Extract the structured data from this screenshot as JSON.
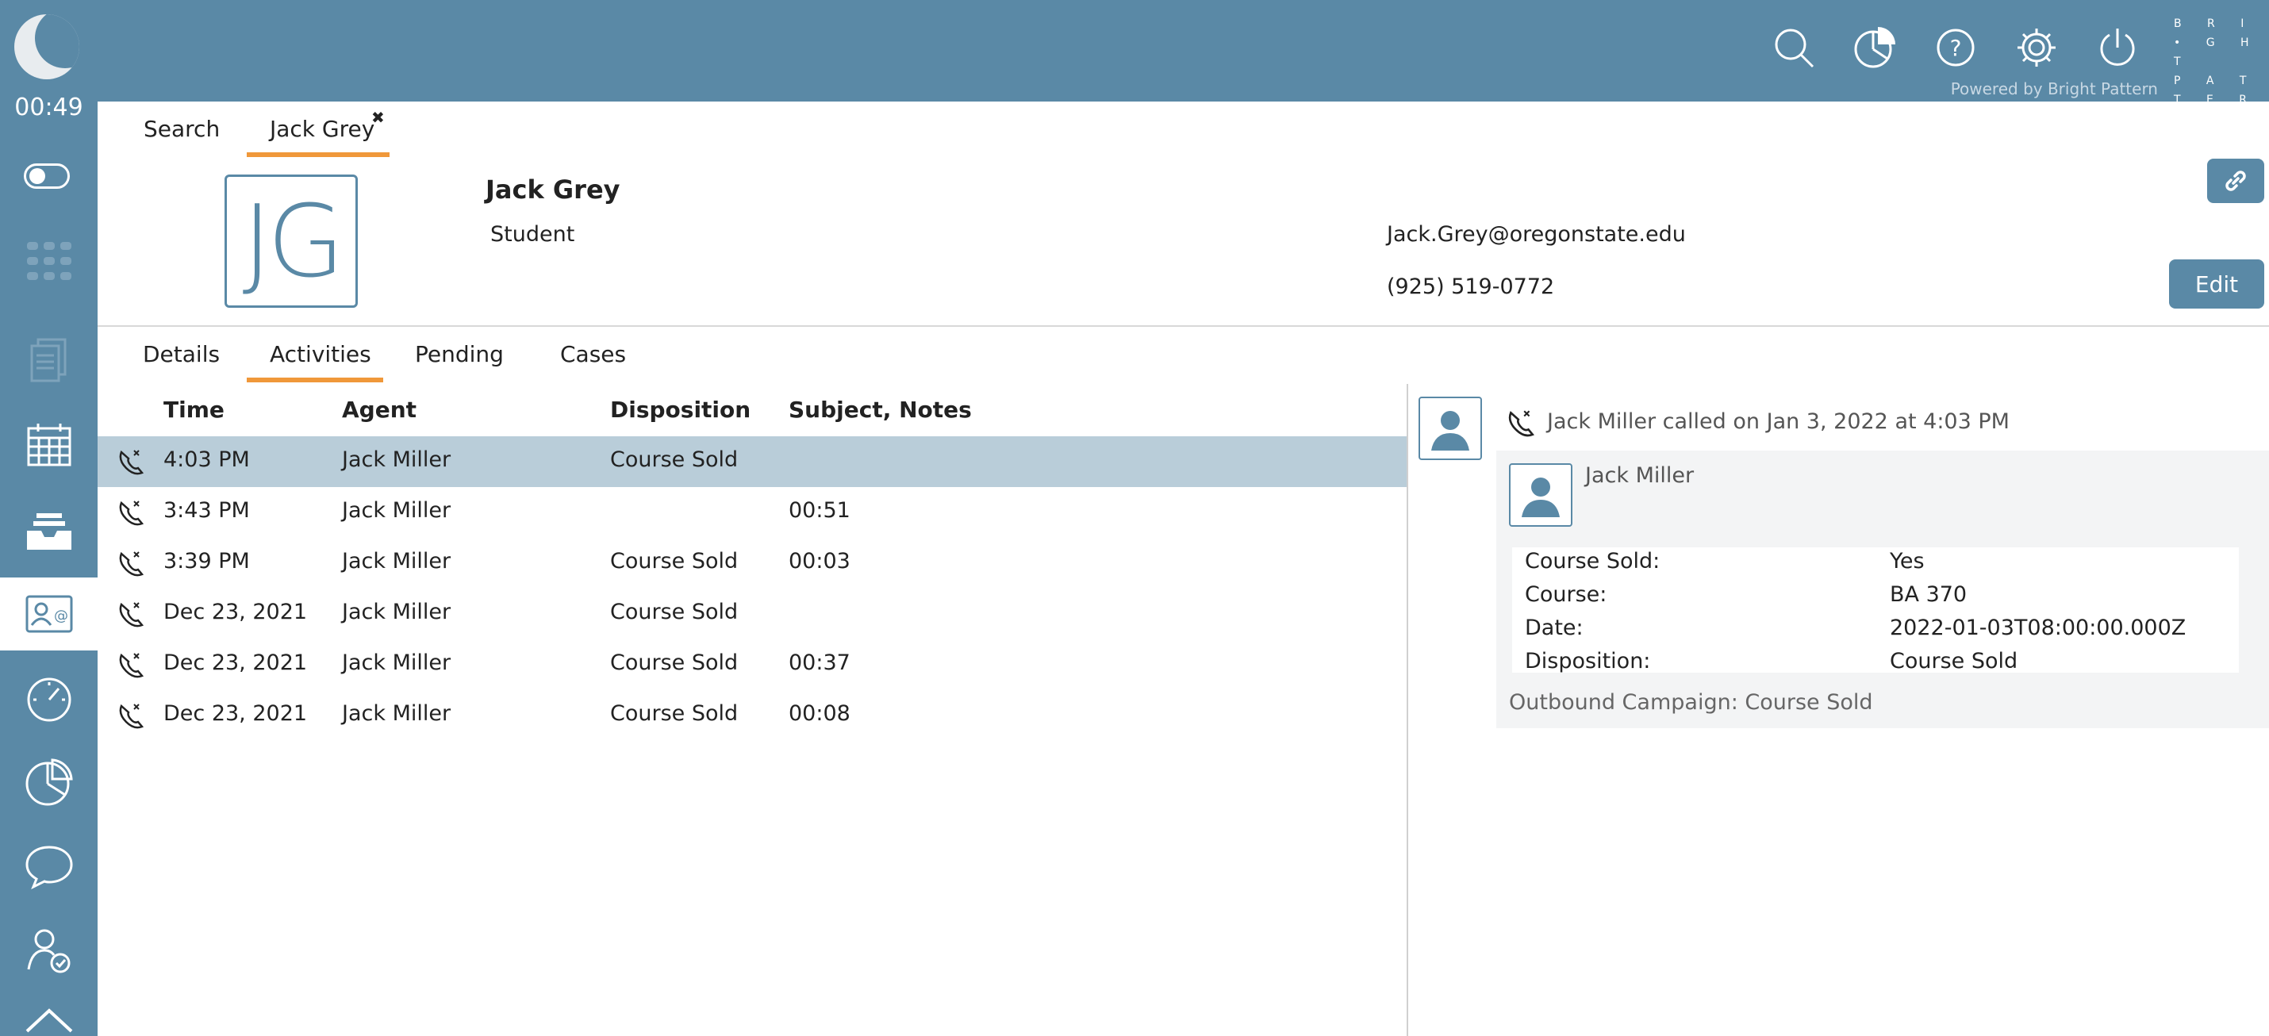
{
  "sidebar": {
    "timer": "00:49"
  },
  "topbar": {
    "logo_lines": [
      "B R I",
      "• G H T",
      "P A T",
      "T E R N"
    ],
    "powered_by": "Powered by Bright Pattern"
  },
  "top_tabs": [
    {
      "label": "Search"
    },
    {
      "label": "Jack Grey",
      "close": "✖"
    }
  ],
  "contact": {
    "initials": "JG",
    "name": "Jack Grey",
    "title": "Student",
    "email": "Jack.Grey@oregonstate.edu",
    "phone": "(925) 519-0772",
    "edit_label": "Edit"
  },
  "sub_tabs": [
    "Details",
    "Activities",
    "Pending",
    "Cases"
  ],
  "activities": {
    "columns": [
      "Time",
      "Agent",
      "Disposition",
      "Subject, Notes"
    ],
    "rows": [
      {
        "time": "4:03 PM",
        "agent": "Jack Miller",
        "disposition": "Course Sold",
        "notes": ""
      },
      {
        "time": "3:43 PM",
        "agent": "Jack Miller",
        "disposition": "",
        "notes": "00:51"
      },
      {
        "time": "3:39 PM",
        "agent": "Jack Miller",
        "disposition": "Course Sold",
        "notes": "00:03"
      },
      {
        "time": "Dec 23, 2021",
        "agent": "Jack Miller",
        "disposition": "Course Sold",
        "notes": ""
      },
      {
        "time": "Dec 23, 2021",
        "agent": "Jack Miller",
        "disposition": "Course Sold",
        "notes": "00:37"
      },
      {
        "time": "Dec 23, 2021",
        "agent": "Jack Miller",
        "disposition": "Course Sold",
        "notes": "00:08"
      }
    ]
  },
  "detail": {
    "header": "Jack Miller called on Jan 3, 2022 at 4:03 PM",
    "agent": "Jack Miller",
    "fields": [
      {
        "label": "Course Sold:",
        "value": "Yes"
      },
      {
        "label": "Course:",
        "value": "BA 370"
      },
      {
        "label": "Date:",
        "value": "2022-01-03T08:00:00.000Z"
      },
      {
        "label": "Disposition:",
        "value": "Course Sold"
      }
    ],
    "campaign": "Outbound Campaign: Course Sold"
  },
  "colors": {
    "brand": "#5a89a6",
    "accent": "#f0983a",
    "selected_row": "#b9cdd9"
  }
}
